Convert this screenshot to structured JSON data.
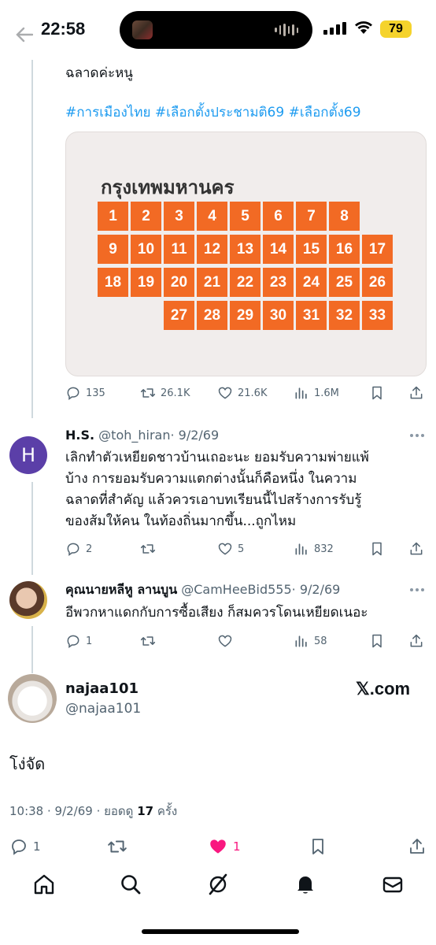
{
  "status_bar": {
    "time": "22:58",
    "battery": "79"
  },
  "tweet_main": {
    "text_tail": "ฉลาดค่ะหนู",
    "hashtags": "#การเมืองไทย #เลือกตั้งประชามติ69 #เลือกตั้ง69",
    "image": {
      "title": "กรุงเทพมหานคร",
      "tiles": [
        "1",
        "2",
        "3",
        "4",
        "5",
        "6",
        "7",
        "8",
        "9",
        "10",
        "11",
        "12",
        "13",
        "14",
        "15",
        "16",
        "17",
        "18",
        "19",
        "20",
        "21",
        "22",
        "23",
        "24",
        "25",
        "26",
        "27",
        "28",
        "29",
        "30",
        "31",
        "32",
        "33"
      ]
    },
    "stats": {
      "replies": "135",
      "retweets": "26.1K",
      "likes": "21.6K",
      "views": "1.6M"
    }
  },
  "reply_1": {
    "avatar_letter": "H",
    "avatar_color": "#5b3fa8",
    "name": "H.S.",
    "handle": "@toh_hiran",
    "date": "· 9/2/69",
    "lines": [
      "เลิกทำตัวเหยียดชาวบ้านเถอะนะ ยอมรับความพ่ายแพ้",
      "บ้าง การยอมรับความแตกต่างนั้นก็คือหนึ่ง ในความ",
      "ฉลาดที่สำคัญ แล้วควรเอาบทเรียนนี้ไปสร้างการรับรู้",
      "ของส้มให้คน ในท้องถิ่นมากขึ้น...ถูกไหม"
    ],
    "stats": {
      "replies": "2",
      "retweets": "",
      "likes": "5",
      "views": "832"
    }
  },
  "reply_2": {
    "name": "คุณนายหลีหู ลานบูน",
    "handle": "@CamHeeBid555",
    "date": "· 9/2/69",
    "text": "อีพวกหาแดกกับการซื้อเสียง ก็สมควรโดนเหยียดเนอะ",
    "stats": {
      "replies": "1",
      "retweets": "",
      "likes": "",
      "views": "58"
    }
  },
  "focused_tweet": {
    "name": "najaa101",
    "handle": "@najaa101",
    "source": "𝕏.com",
    "text": "โง่จัด",
    "meta_prefix": "10:38 · 9/2/69 · ยอดดู",
    "view_count": "17",
    "meta_suffix": "ครั้ง",
    "stats": {
      "replies": "1",
      "likes": "1"
    },
    "like_color": "#f91880"
  },
  "tabbar": {
    "items": [
      "home-icon",
      "search-icon",
      "grok-icon",
      "notifications-icon",
      "messages-icon"
    ]
  }
}
